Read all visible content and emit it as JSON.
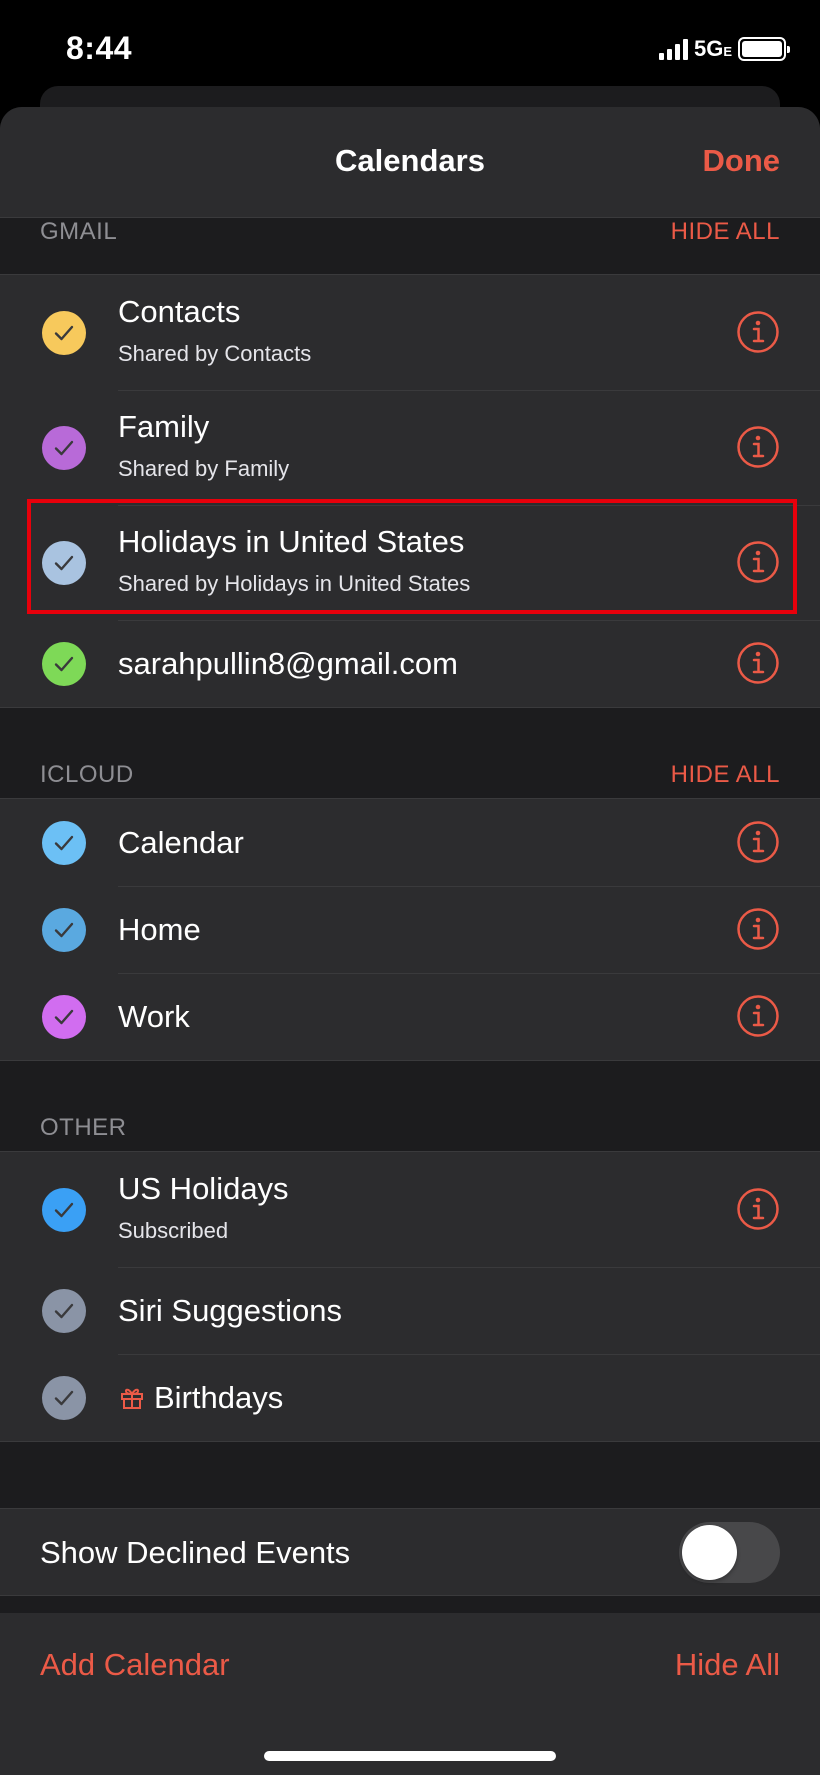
{
  "status": {
    "time": "8:44",
    "network": "5G",
    "network_suffix": "E"
  },
  "nav": {
    "title": "Calendars",
    "done_label": "Done"
  },
  "sections": {
    "gmail": {
      "label": "GMAIL",
      "hide_all": "HIDE ALL",
      "items": [
        {
          "title": "Contacts",
          "subtitle": "Shared by Contacts",
          "color": "#f7c95c"
        },
        {
          "title": "Family",
          "subtitle": "Shared by Family",
          "color": "#b86ad8"
        },
        {
          "title": "Holidays in United States",
          "subtitle": "Shared by Holidays in United States",
          "color": "#a9c3e0"
        },
        {
          "title": "sarahpullin8@gmail.com",
          "color": "#7ed957"
        }
      ]
    },
    "icloud": {
      "label": "ICLOUD",
      "hide_all": "HIDE ALL",
      "items": [
        {
          "title": "Calendar",
          "color": "#6cc0f5"
        },
        {
          "title": "Home",
          "color": "#5aa9e0"
        },
        {
          "title": "Work",
          "color": "#d16df0"
        }
      ]
    },
    "other": {
      "label": "OTHER",
      "items": [
        {
          "title": "US Holidays",
          "subtitle": "Subscribed",
          "color": "#3aa0f5"
        },
        {
          "title": "Siri Suggestions",
          "color": "#8a94a6"
        },
        {
          "title": "Birthdays",
          "color": "#8a94a6",
          "icon": "gift-icon"
        }
      ]
    }
  },
  "declined": {
    "label": "Show Declined Events",
    "enabled": false
  },
  "toolbar": {
    "add_label": "Add Calendar",
    "hide_label": "Hide All"
  },
  "colors": {
    "accent": "#eb5a47",
    "highlight": "#e8000b"
  }
}
